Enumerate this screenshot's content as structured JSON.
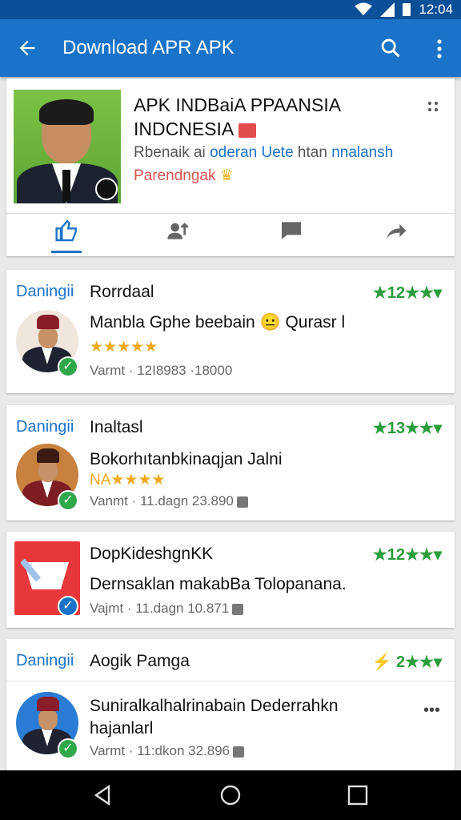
{
  "status": {
    "time": "12:04"
  },
  "appbar": {
    "title": "Download APR APK"
  },
  "profile": {
    "name_line1": "APK INDBaiA PPAANSIA",
    "name_line2": "INDCNESIA",
    "sub_grey": "Rbenaik ai",
    "sub_blue1": "oderan Uete",
    "sub_grey2": "htan",
    "sub_blue2": "nnalansh",
    "sub_red": "Parendngak"
  },
  "tabs": [
    "like",
    "followers",
    "comments",
    "share"
  ],
  "cards": [
    {
      "source": "Daningii",
      "author": "Rorrdaal",
      "rating": "★12★★▾",
      "line1": "Manbla Gphe beebain 😐 Qurasr l",
      "stars": "★★★★★",
      "meta": "Varmt · 12I8983 ·18000"
    },
    {
      "source": "Daningii",
      "author": "Inaltasl",
      "rating": "★13★★▾",
      "line1": "Bokorhıtanbkinaqjan Jalni",
      "stars": "NA★★★★",
      "meta": "Vanmt · 11.dagn 23.890"
    },
    {
      "author": "DopKideshgnKK",
      "rating": "★12★★▾",
      "line1": "Dernsaklan makabBa Tolopanana.",
      "meta": "Vajmt · 11.dagn 10.871"
    },
    {
      "source": "Daningii",
      "author": "Aogik Pamga",
      "rating": "2★★▾",
      "line1": "Suniralkalhalrinabain Dederrahkn",
      "line2": "hajanlarl",
      "meta": "Varmt · 11:dkon 32.896"
    }
  ],
  "colors": {
    "appbar": "#1a73c8",
    "statusbar": "#0b4f99",
    "rating": "#2a9d3c",
    "stars": "#f2a81d"
  }
}
